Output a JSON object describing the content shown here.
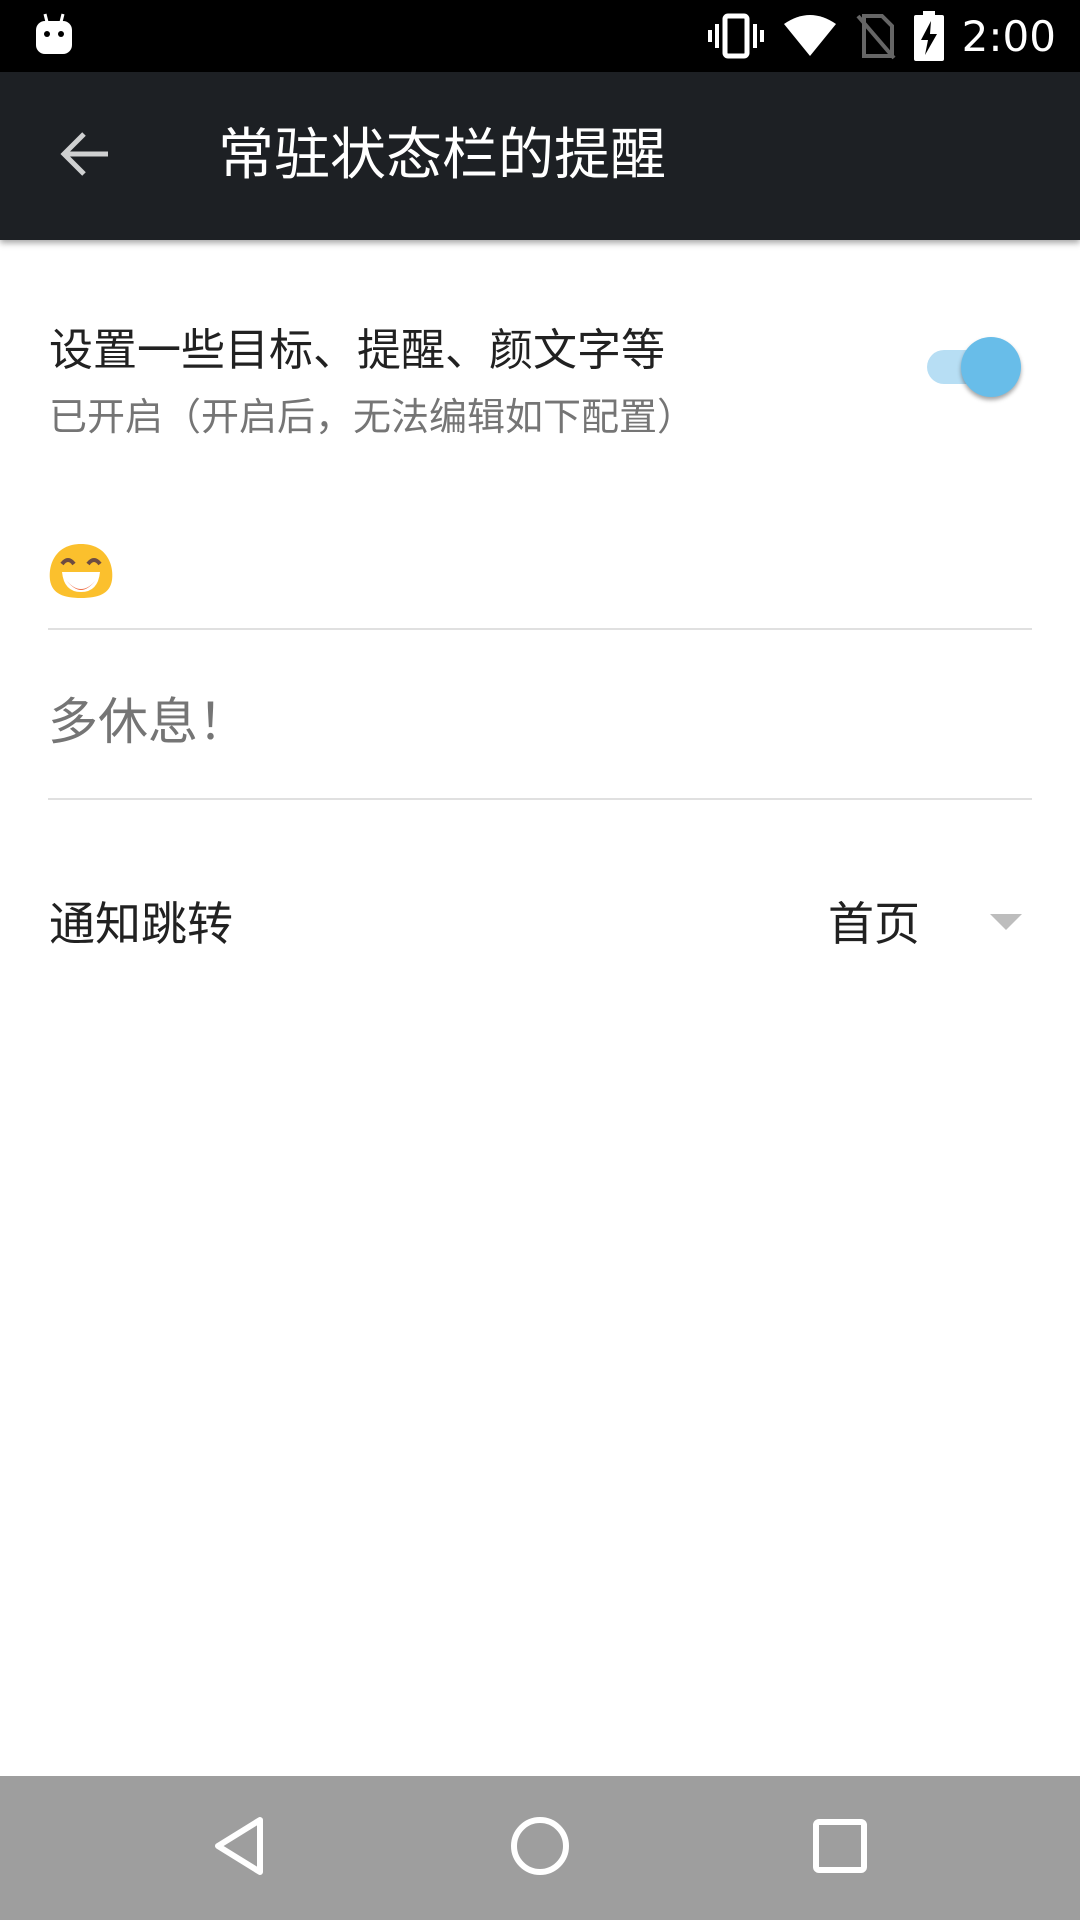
{
  "status_bar": {
    "time": "2:00",
    "icons": [
      "android-app-icon",
      "vibrate-icon",
      "wifi-icon",
      "no-sim-icon",
      "battery-charging-icon"
    ]
  },
  "toolbar": {
    "back_icon": "arrow-back-icon",
    "title": "常驻状态栏的提醒"
  },
  "settings": {
    "toggle": {
      "title": "设置一些目标、提醒、颜文字等",
      "subtitle": "已开启（开启后，无法编辑如下配置）",
      "checked": true,
      "track_color": "#b7def4",
      "thumb_color": "#68bde9"
    },
    "emoji_field": {
      "value_icon": "smiling-face-emoji"
    },
    "text_field": {
      "value": "多休息！"
    },
    "jump": {
      "label": "通知跳转",
      "selected": "首页"
    }
  },
  "nav_bar": {
    "buttons": [
      "back-triangle-icon",
      "home-circle-icon",
      "recents-square-icon"
    ]
  },
  "colors": {
    "toolbar_bg": "#1d2024",
    "nav_bg": "#9e9e9e"
  }
}
